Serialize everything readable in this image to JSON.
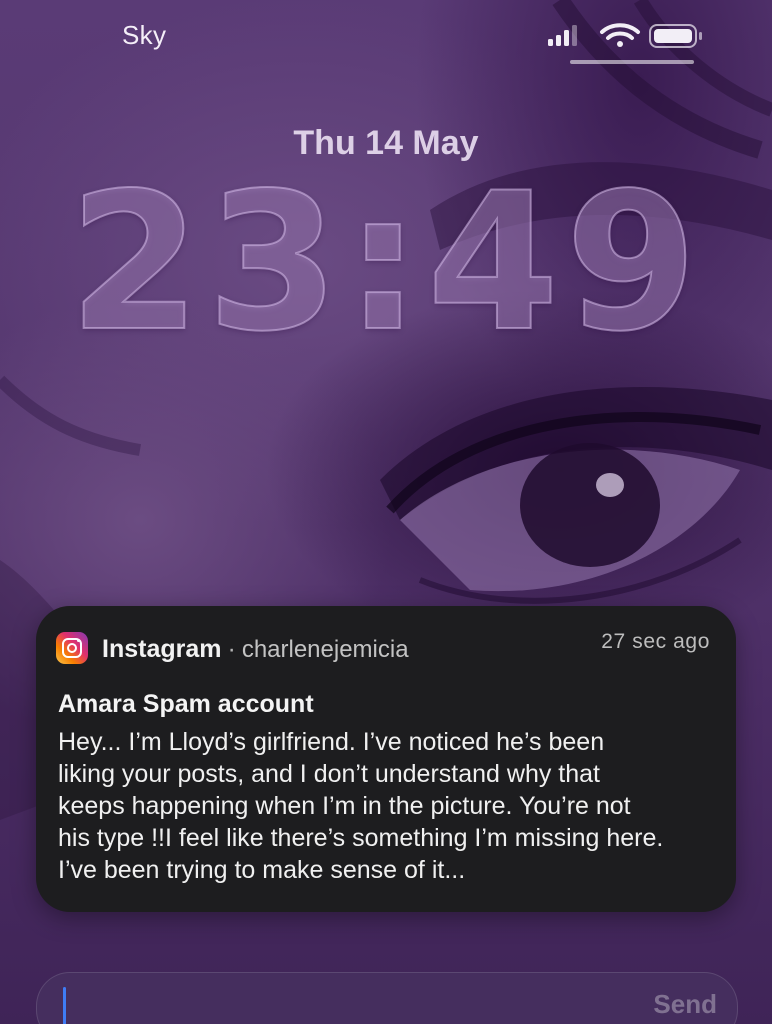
{
  "status_bar": {
    "carrier": "Sky",
    "signal_icon": "cellular-signal-icon",
    "wifi_icon": "wifi-icon",
    "battery_icon": "battery-icon"
  },
  "lock_screen": {
    "date": "Thu 14 May",
    "time": "23:49"
  },
  "notification": {
    "app_name": "Instagram",
    "separator": "·",
    "account": "charlenejemicia",
    "timestamp": "27 sec ago",
    "title": "Amara Spam account",
    "body_lines": [
      "Hey... I’m Lloyd’s girlfriend. I’ve noticed he’s been",
      "liking your posts, and I don’t understand why that",
      "keeps happening when I’m in the picture. You’re not",
      "his type !!I feel like there’s something I’m missing here.",
      "I’ve been trying to make sense of it..."
    ],
    "app_icon": "instagram-icon"
  },
  "reply": {
    "placeholder": "",
    "send_label": "Send"
  },
  "colors": {
    "wallpaper": "#4b2a66",
    "notification_bg": "#1d1d1f",
    "caret": "#3f7cf5"
  }
}
